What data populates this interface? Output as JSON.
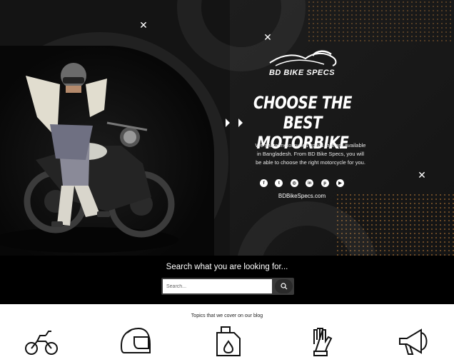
{
  "hero": {
    "logo_text": "BD BIKE SPECS",
    "headline_line1": "CHOOSE THE BEST",
    "headline_line2": "MOTORBIKE",
    "description": "We share motorcycles specs that are available in Bangladesh. From BD Bike Specs, you will be able to choose the right motorcycle for you.",
    "social_icons": [
      "facebook-icon",
      "twitter-icon",
      "instagram-icon",
      "linkedin-icon",
      "pinterest-icon",
      "youtube-icon"
    ],
    "site_link": "BDBikeSpecs.com"
  },
  "search": {
    "title": "Search what you are looking for...",
    "placeholder": "Search..."
  },
  "topics": {
    "title": "Topics that we cover on our blog",
    "icons": [
      "motorcycle-icon",
      "helmet-icon",
      "fuel-can-icon",
      "glove-icon",
      "megaphone-icon"
    ]
  },
  "colors": {
    "hero_bg": "#141414",
    "accent_dots": "#d68c3c",
    "search_band": "#000000"
  }
}
